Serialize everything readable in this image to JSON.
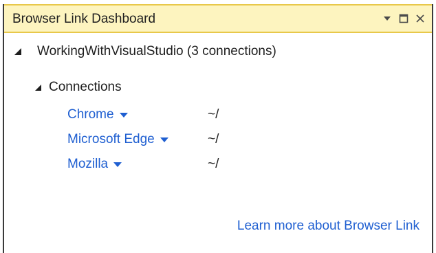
{
  "window": {
    "title": "Browser Link Dashboard",
    "controls": [
      "dropdown-icon",
      "maximize-icon",
      "close-icon"
    ]
  },
  "tree": {
    "project_label": "WorkingWithVisualStudio (3 connections)",
    "connections_label": "Connections",
    "connections": [
      {
        "browser": "Chrome",
        "path": "~/"
      },
      {
        "browser": "Microsoft Edge",
        "path": "~/"
      },
      {
        "browser": "Mozilla",
        "path": "~/"
      }
    ]
  },
  "footer": {
    "learn_more": "Learn more about Browser Link"
  },
  "colors": {
    "title_bg": "#fdf4bf",
    "title_border": "#e8c84a",
    "link": "#1f5fd1"
  }
}
